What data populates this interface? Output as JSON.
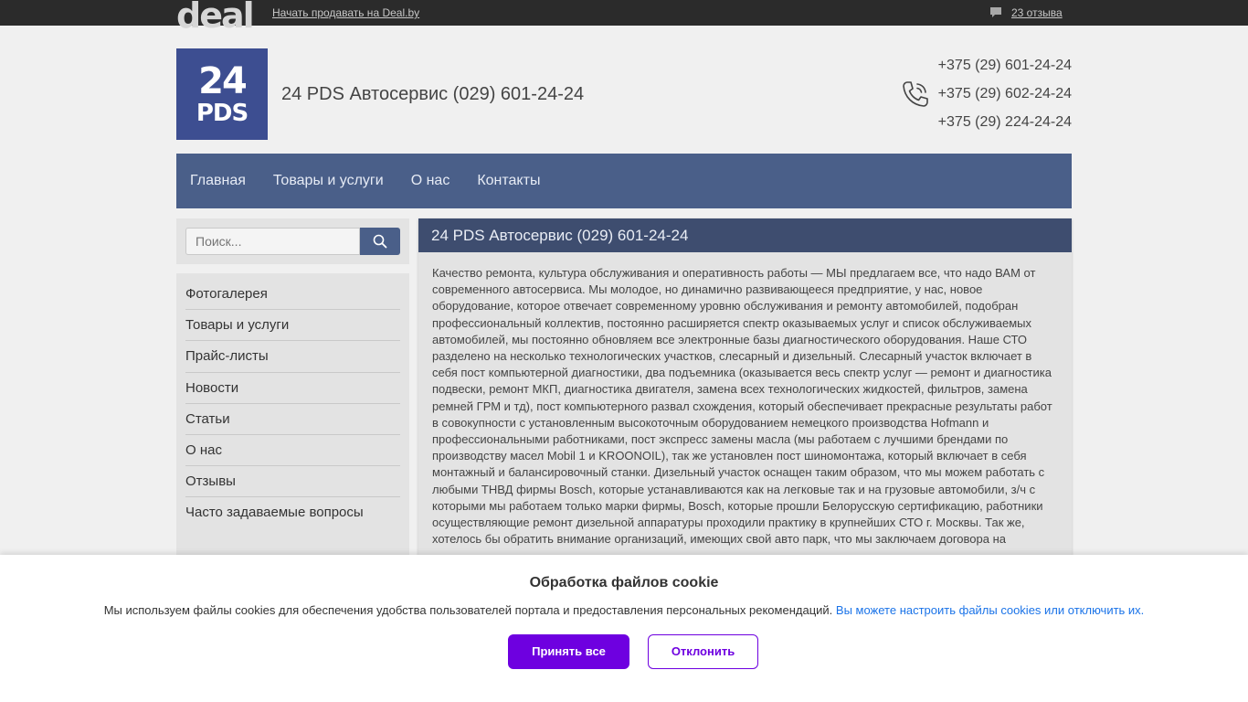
{
  "topbar": {
    "logo": "deal",
    "sell_link": "Начать продавать на Deal.by",
    "reviews": "23 отзыва"
  },
  "header": {
    "logo_line1": "24",
    "logo_line2": "PDS",
    "title": "24 PDS Автосервис (029) 601-24-24",
    "phones": [
      "+375 (29) 601-24-24",
      "+375 (29) 602-24-24",
      "+375 (29) 224-24-24"
    ]
  },
  "nav": [
    "Главная",
    "Товары и услуги",
    "О нас",
    "Контакты"
  ],
  "search": {
    "placeholder": "Поиск..."
  },
  "side_menu": [
    "Фотогалерея",
    "Товары и услуги",
    "Прайс-листы",
    "Новости",
    "Статьи",
    "О нас",
    "Отзывы",
    "Часто задаваемые вопросы"
  ],
  "content": {
    "title": "24 PDS Автосервис (029) 601-24-24",
    "text": "Качество ремонта, культура обслуживания и оперативность работы — МЫ предлагаем все, что надо ВАМ от современного автосервиса. Мы молодое, но динамично развивающееся предприятие, у нас, новое оборудование, которое отвечает современному уровню обслуживания и ремонту автомобилей, подобран профессиональный коллектив, постоянно расширяется спектр оказываемых услуг и список обслуживаемых автомобилей, мы постоянно обновляем все электронные базы диагностического оборудования. Наше СТО разделено на несколько технологических участков, слесарный и дизельный. Слесарный участок включает в себя пост компьютерной диагностики, два подъемника (оказывается весь спектр услуг — ремонт и диагностика подвески, ремонт МКП, диагностика двигателя, замена всех технологических жидкостей, фильтров, замена ремней ГРМ и тд), пост компьютерного развал схождения, который обеспечивает прекрасные результаты работ в совокупности с установленным высокоточным оборудованием немецкого производства Hofmann и профессиональными работниками, пост экспресс замены масла (мы работаем с лучшими брендами по производству масел Mobil 1 и KROONOIL), так же установлен пост шиномонтажа, который включает в себя монтажный и балансировочный станки. Дизельный участок оснащен таким образом, что мы можем работать с любыми ТНВД фирмы Bosch, которые устанавливаются как на легковые так и на грузовые автомобили, з/ч с которыми мы работаем только марки фирмы, Bosch, которые прошли Белорусскую сертификацию, работники осуществляющие ремонт дизельной аппаратуры проходили практику в крупнейших СТО г. Москвы. Так же, хотелось бы обратить внимание организаций, имеющих свой авто парк, что мы заключаем договора на"
  },
  "cookie": {
    "title": "Обработка файлов cookie",
    "text": "Мы используем файлы cookies для обеспечения удобства пользователей портала и предоставления персональных рекомендаций.",
    "link": "Вы можете настроить файлы cookies или отключить их.",
    "accept": "Принять все",
    "decline": "Отклонить"
  },
  "colors": {
    "brand_logo_bg": "#3d4e91",
    "nav_bg": "#4a5f89",
    "content_head_bg": "#3e4d6f",
    "cookie_accent": "#6e00e0",
    "cookie_link": "#1a73e8"
  }
}
